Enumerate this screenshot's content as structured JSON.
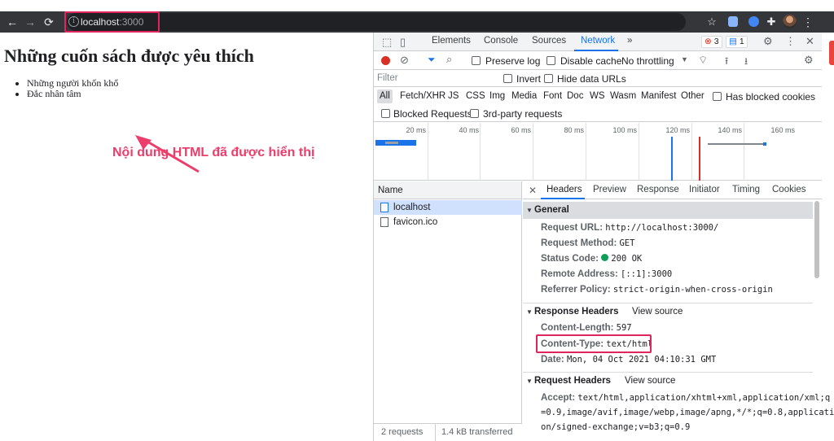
{
  "browser": {
    "url_host": "localhost",
    "url_port": ":3000"
  },
  "page": {
    "heading": "Những cuốn sách được yêu thích",
    "list_items": [
      "Những người khốn khổ",
      "Đắc nhân tâm"
    ],
    "annotation": "Nội dung HTML đã được hiển thị"
  },
  "devtools": {
    "tabs": [
      "Elements",
      "Console",
      "Sources",
      "Network",
      "»"
    ],
    "active_tab": "Network",
    "error_count": "3",
    "message_count": "1",
    "preserve_log": "Preserve log",
    "disable_cache": "Disable cache",
    "throttling": "No throttling",
    "filter_placeholder": "Filter",
    "invert": "Invert",
    "hide_data_urls": "Hide data URLs",
    "type_filters": [
      "All",
      "Fetch/XHR",
      "JS",
      "CSS",
      "Img",
      "Media",
      "Font",
      "Doc",
      "WS",
      "Wasm",
      "Manifest",
      "Other"
    ],
    "has_blocked_cookies": "Has blocked cookies",
    "blocked_requests": "Blocked Requests",
    "third_party": "3rd-party requests",
    "timeline_ticks": [
      "20 ms",
      "40 ms",
      "60 ms",
      "80 ms",
      "100 ms",
      "120 ms",
      "140 ms",
      "160 ms"
    ],
    "name_header": "Name",
    "requests": [
      "localhost",
      "favicon.ico"
    ],
    "status_requests": "2 requests",
    "status_transferred": "1.4 kB transferred",
    "detail_tabs": [
      "Headers",
      "Preview",
      "Response",
      "Initiator",
      "Timing",
      "Cookies"
    ],
    "general": {
      "title": "General",
      "request_url_k": "Request URL:",
      "request_url_v": "http://localhost:3000/",
      "method_k": "Request Method:",
      "method_v": "GET",
      "status_k": "Status Code:",
      "status_v": "200 OK",
      "remote_k": "Remote Address:",
      "remote_v": "[::1]:3000",
      "referrer_k": "Referrer Policy:",
      "referrer_v": "strict-origin-when-cross-origin"
    },
    "response_headers": {
      "title": "Response Headers",
      "view_source": "View source",
      "length_k": "Content-Length:",
      "length_v": "597",
      "type_k": "Content-Type:",
      "type_v": "text/html",
      "date_k": "Date:",
      "date_v": "Mon, 04 Oct 2021 04:10:31 GMT"
    },
    "request_headers": {
      "title": "Request Headers",
      "view_source": "View source",
      "accept_k": "Accept:",
      "accept_v1": "text/html,application/xhtml+xml,application/xml;q",
      "accept_v2": "=0.9,image/avif,image/webp,image/apng,*/*;q=0.8,applicati",
      "accept_v3": "on/signed-exchange;v=b3;q=0.9"
    }
  },
  "colors": {
    "annotation": "#ec3d6b",
    "highlight_border": "#e0245e",
    "network_accent": "#1a73e8"
  }
}
